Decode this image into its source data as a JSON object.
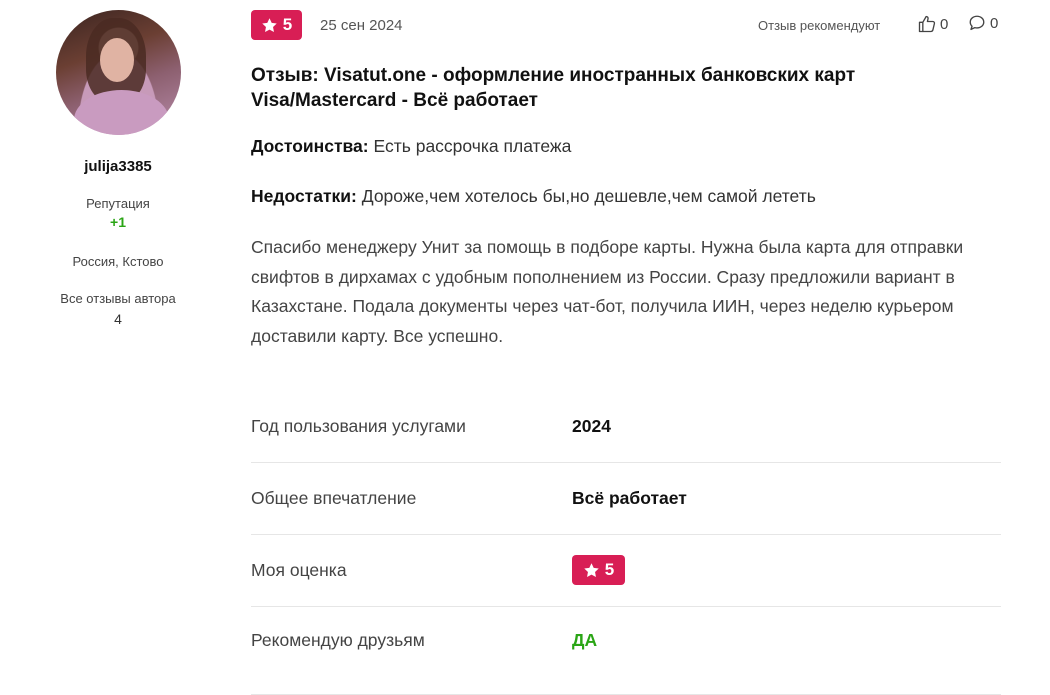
{
  "author": {
    "username": "julija3385",
    "reputation_label": "Репутация",
    "reputation_value": "+1",
    "location": "Россия, Кстово",
    "all_reviews_label": "Все отзывы автора",
    "all_reviews_count": "4"
  },
  "review": {
    "rating": "5",
    "date": "25 сен 2024",
    "recommend_label": "Отзыв рекомендуют",
    "likes": "0",
    "comments": "0",
    "title": "Отзыв: Visatut.one - оформление иностранных банковских карт Visa/Mastercard - Всё работает",
    "pros_label": "Достоинства:",
    "pros": "Есть рассрочка платежа",
    "cons_label": "Недостатки:",
    "cons": "Дороже,чем хотелось бы,но дешевле,чем самой лететь",
    "text": "Спасибо менеджеру Унит за помощь в подборе карты. Нужна была карта для отправки свифтов в дирхамах с удобным пополнением из России. Сразу предложили вариант в Казахстане. Подала документы через чат-бот, получила ИИН, через неделю курьером доставили карту. Все успешно."
  },
  "details": {
    "year_label": "Год пользования услугами",
    "year_value": "2024",
    "impression_label": "Общее впечатление",
    "impression_value": "Всё работает",
    "my_rating_label": "Моя оценка",
    "my_rating_value": "5",
    "recommend_friends_label": "Рекомендую друзьям",
    "recommend_friends_value": "ДА"
  },
  "colors": {
    "badge": "#d81e55",
    "positive": "#2aa515"
  },
  "icons": [
    "star-icon",
    "thumbs-up-icon",
    "comment-icon"
  ]
}
